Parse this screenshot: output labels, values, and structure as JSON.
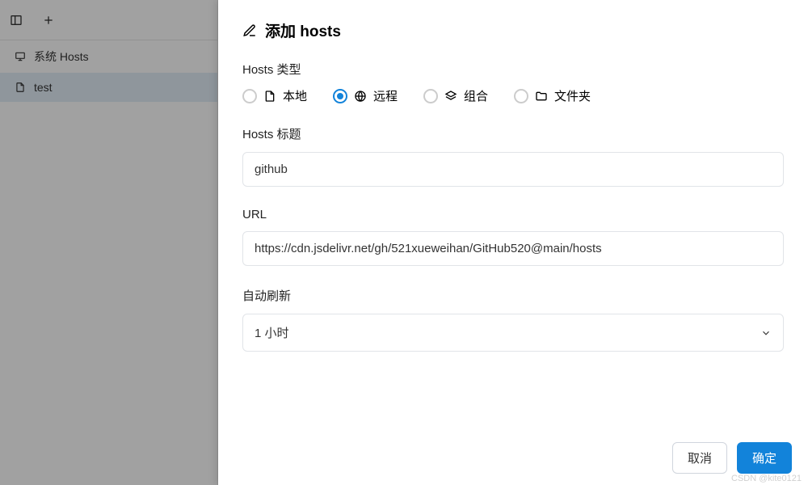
{
  "sidebar": {
    "items": [
      {
        "label": "系统 Hosts"
      },
      {
        "label": "test"
      }
    ]
  },
  "panel": {
    "title": "添加 hosts",
    "type_section": {
      "label": "Hosts 类型",
      "options": [
        {
          "label": "本地",
          "checked": false
        },
        {
          "label": "远程",
          "checked": true
        },
        {
          "label": "组合",
          "checked": false
        },
        {
          "label": "文件夹",
          "checked": false
        }
      ]
    },
    "title_section": {
      "label": "Hosts 标题",
      "value": "github"
    },
    "url_section": {
      "label": "URL",
      "value": "https://cdn.jsdelivr.net/gh/521xueweihan/GitHub520@main/hosts"
    },
    "refresh_section": {
      "label": "自动刷新",
      "value": "1 小时"
    },
    "buttons": {
      "cancel": "取消",
      "confirm": "确定"
    }
  },
  "watermark": "CSDN @kite0121"
}
